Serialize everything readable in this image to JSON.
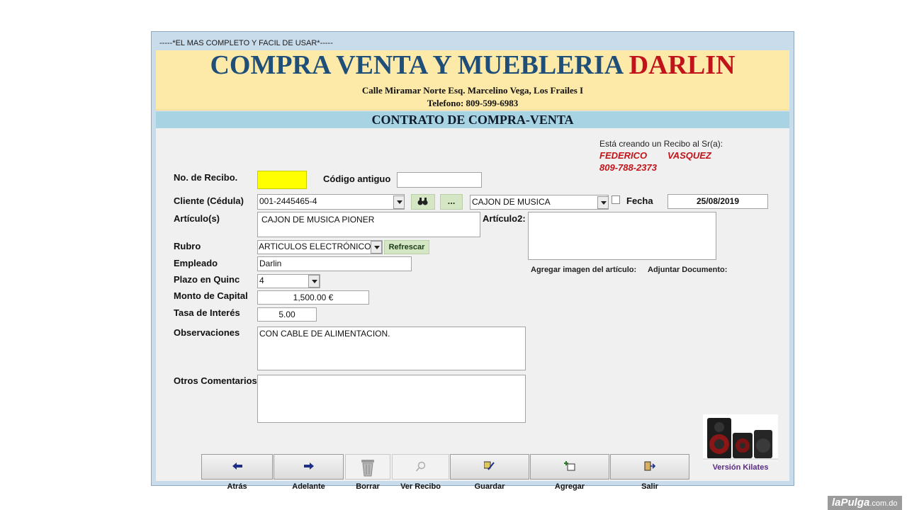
{
  "window": {
    "title": "-----*EL MAS COMPLETO Y FACIL DE USAR*-----"
  },
  "header": {
    "company_main": "COMPRA VENTA Y MUEBLERIA",
    "company_brand": "DARLIN",
    "address": "Calle Miramar Norte Esq. Marcelino Vega, Los Frailes I",
    "phone": "Telefono: 809-599-6983",
    "form_title": "CONTRATO DE COMPRA-VENTA"
  },
  "customer_info": {
    "caption": "Está creando un Recibo al Sr(a):",
    "first_name": "FEDERICO",
    "last_name": "VASQUEZ",
    "phone": "809-788-2373"
  },
  "form": {
    "receipt_no_label": "No. de Recibo.",
    "receipt_no_value": "",
    "old_code_label": "Código antiguo",
    "old_code_value": "",
    "client_label": "Cliente (Cédula)",
    "client_value": "001-2445465-4",
    "more_button": "...",
    "article_combo_value": "CAJON DE MUSICA",
    "date_label": "Fecha",
    "date_value": "25/08/2019",
    "articles_label": "Artículo(s)",
    "articles_value": "CAJON DE MUSICA PIONER",
    "article2_label": "Artículo2:",
    "article2_value": "",
    "category_label": "Rubro",
    "category_value": "ARTICULOS ELECTRÓNICOS",
    "refresh_button": "Refrescar",
    "employee_label": "Empleado",
    "employee_value": "Darlin",
    "term_label": "Plazo en Quinc",
    "term_value": "4",
    "capital_label": "Monto de Capital",
    "capital_value": "1,500.00 €",
    "rate_label": "Tasa de Interés",
    "rate_value": "5.00",
    "observations_label": "Observaciones",
    "observations_value": "CON CABLE DE ALIMENTACION.",
    "comments_label": "Otros Comentarios",
    "comments_value": "",
    "add_image_label": "Agregar imagen del artículo:",
    "attach_doc_label": "Adjuntar Documento:"
  },
  "buttons": {
    "back": "Atrás",
    "forward": "Adelante",
    "delete": "Borrar",
    "view": "Ver Recibo",
    "save": "Guardar",
    "add": "Agregar",
    "exit": "Salir"
  },
  "version_label": "Versión Kilates",
  "watermark": {
    "brand": "laPulga",
    "domain": ".com.do"
  },
  "colors": {
    "header_bg": "#fde9a8",
    "title_blue": "#1f4f79",
    "brand_red": "#c0141a",
    "band_blue": "#a8d3e3",
    "receipt_yellow": "#ffff00"
  }
}
